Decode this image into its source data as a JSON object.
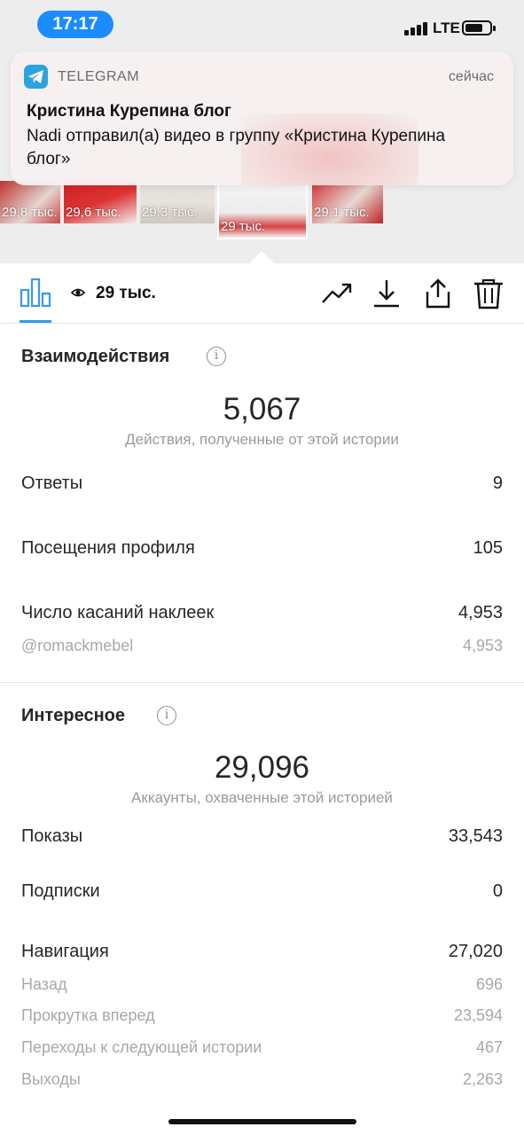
{
  "status_bar": {
    "time": "17:17",
    "network": "LTE"
  },
  "notification": {
    "app_name": "TELEGRAM",
    "time": "сейчас",
    "title": "Кристина Курепина блог",
    "body": "Nadi отправил(а) видео в группу «Кристина Курепина блог»"
  },
  "thumbnails": [
    {
      "views": "29,8 тыс."
    },
    {
      "views": "29,6 тыс."
    },
    {
      "views": "29,3 тыс."
    },
    {
      "views": "29 тыс."
    },
    {
      "views": "29,1 тыс."
    }
  ],
  "toolbar": {
    "views": "29 тыс."
  },
  "interactions": {
    "title": "Взаимодействия",
    "total": "5,067",
    "caption": "Действия, полученные от этой истории",
    "rows": [
      {
        "label": "Ответы",
        "value": "9"
      },
      {
        "label": "Посещения профиля",
        "value": "105"
      },
      {
        "label": "Число касаний наклеек",
        "value": "4,953"
      }
    ],
    "sub_rows": [
      {
        "label": "@romackmebel",
        "value": "4,953"
      }
    ]
  },
  "discovery": {
    "title": "Интересное",
    "total": "29,096",
    "caption": "Аккаунты, охваченные этой историей",
    "rows": [
      {
        "label": "Показы",
        "value": "33,543"
      },
      {
        "label": "Подписки",
        "value": "0"
      },
      {
        "label": "Навигация",
        "value": "27,020"
      }
    ],
    "sub_rows": [
      {
        "label": "Назад",
        "value": "696"
      },
      {
        "label": "Прокрутка вперед",
        "value": "23,594"
      },
      {
        "label": "Переходы к следующей истории",
        "value": "467"
      },
      {
        "label": "Выходы",
        "value": "2,263"
      }
    ]
  },
  "colors": {
    "accent": "#3897f0",
    "time_pill": "#1a8cff",
    "telegram": "#2aa3e0"
  }
}
